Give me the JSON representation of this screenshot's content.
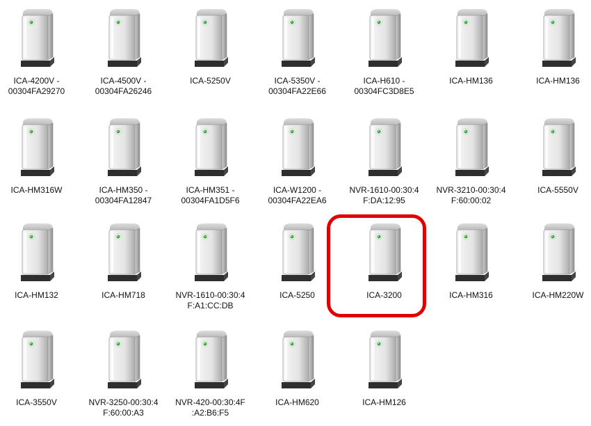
{
  "devices": [
    {
      "label": [
        "ICA-4200V -",
        "00304FA29270"
      ]
    },
    {
      "label": [
        "ICA-4500V -",
        "00304FA26246"
      ]
    },
    {
      "label": [
        "ICA-5250V"
      ]
    },
    {
      "label": [
        "ICA-5350V -",
        "00304FA22E66"
      ]
    },
    {
      "label": [
        "ICA-H610 -",
        "00304FC3D8E5"
      ]
    },
    {
      "label": [
        "ICA-HM136"
      ]
    },
    {
      "label": [
        "ICA-HM136"
      ]
    },
    {
      "label": [
        "ICA-HM316W"
      ]
    },
    {
      "label": [
        "ICA-HM350 -",
        "00304FA12847"
      ]
    },
    {
      "label": [
        "ICA-HM351 -",
        "00304FA1D5F6"
      ]
    },
    {
      "label": [
        "ICA-W1200 -",
        "00304FA22EA6"
      ]
    },
    {
      "label": [
        "NVR-1610-00:30:4",
        "F:DA:12:95"
      ]
    },
    {
      "label": [
        "NVR-3210-00:30:4",
        "F:60:00:02"
      ]
    },
    {
      "label": [
        "ICA-5550V"
      ]
    },
    {
      "label": [
        "ICA-HM132"
      ]
    },
    {
      "label": [
        "ICA-HM718"
      ]
    },
    {
      "label": [
        "NVR-1610-00:30:4",
        "F:A1:CC:DB"
      ]
    },
    {
      "label": [
        "ICA-5250"
      ]
    },
    {
      "label": [
        "ICA-3200"
      ],
      "highlighted": true
    },
    {
      "label": [
        "ICA-HM316"
      ]
    },
    {
      "label": [
        "ICA-HM220W"
      ]
    },
    {
      "label": [
        "ICA-3550V"
      ]
    },
    {
      "label": [
        "NVR-3250-00:30:4",
        "F:60:00:A3"
      ]
    },
    {
      "label": [
        "NVR-420-00:30:4F",
        ":A2:B6:F5"
      ]
    },
    {
      "label": [
        "ICA-HM620"
      ]
    },
    {
      "label": [
        "ICA-HM126"
      ]
    }
  ],
  "icon": "network-device-tower-icon",
  "colors": {
    "highlight": "#e00000",
    "led": "#3caa3c"
  }
}
